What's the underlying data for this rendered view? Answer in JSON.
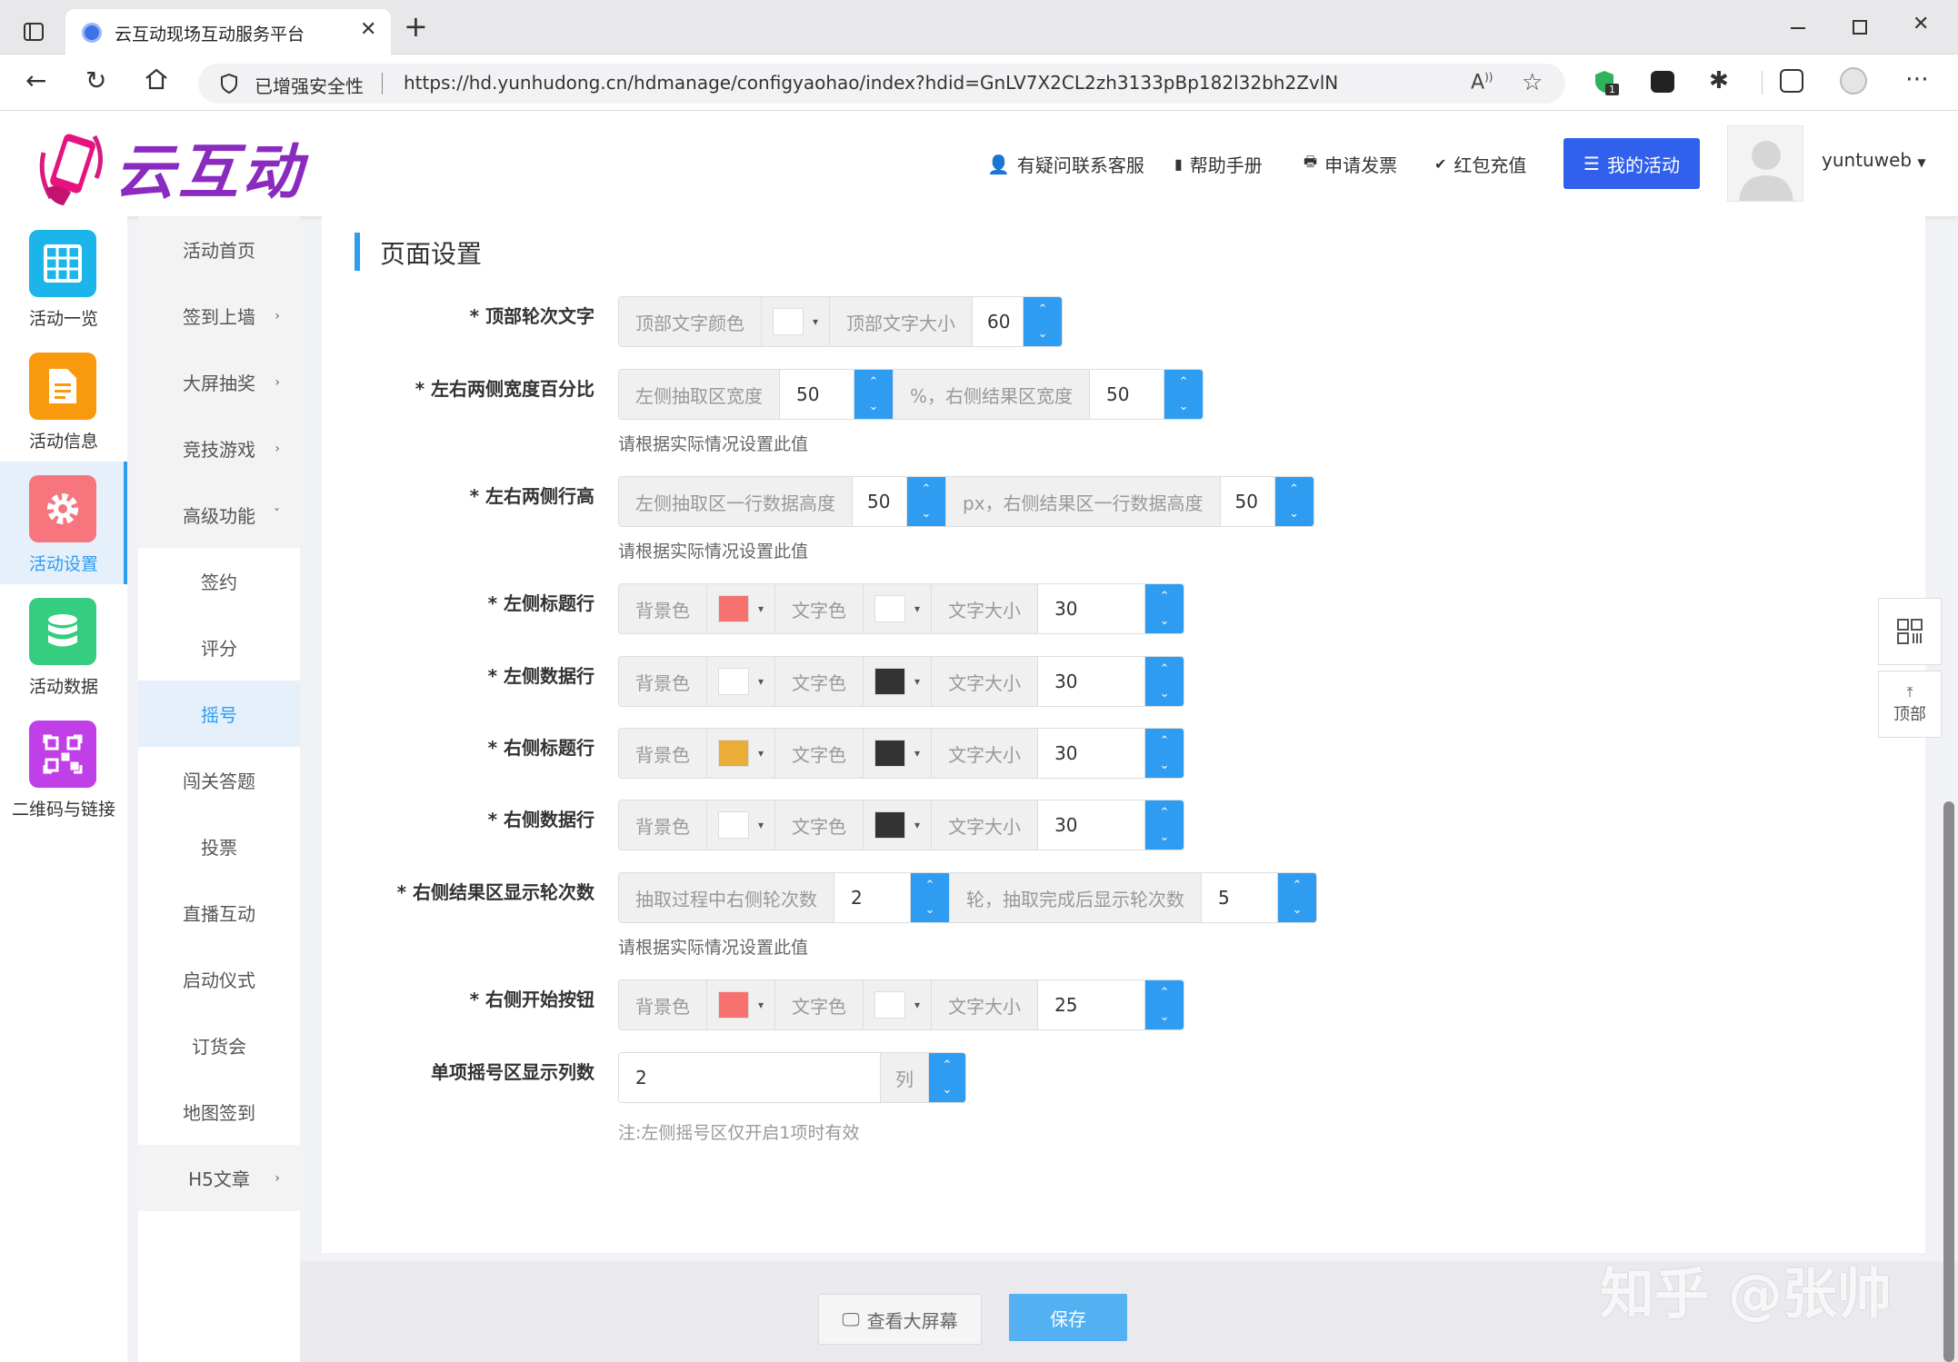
{
  "browser": {
    "tab_title": "云互动现场互动服务平台",
    "security_label": "已增强安全性",
    "url": "https://hd.yunhudong.cn/hdmanage/configyaohao/index?hdid=GnLV7X2CL2zh3133pBp182l32bh2ZvlN",
    "extension_badge": "1"
  },
  "header": {
    "logo_text": "云互动",
    "links": [
      "有疑问联系客服",
      "帮助手册",
      "申请发票",
      "红包充值"
    ],
    "my_activity_button": "我的活动",
    "username": "yuntuweb"
  },
  "sidebar": {
    "items": [
      {
        "label": "活动一览",
        "color": "#1cb5ea",
        "icon": "grid-icon"
      },
      {
        "label": "活动信息",
        "color": "#f99a0e",
        "icon": "document-icon"
      },
      {
        "label": "活动设置",
        "color": "#f7767e",
        "icon": "gear-icon"
      },
      {
        "label": "活动数据",
        "color": "#35cd7f",
        "icon": "database-icon"
      },
      {
        "label": "二维码与链接",
        "color": "#c13fe6",
        "icon": "qrcode-icon"
      }
    ],
    "active_index": 2
  },
  "subnav": {
    "items": [
      "活动首页",
      "签到上墙",
      "大屏抽奖",
      "竞技游戏",
      "高级功能",
      "签约",
      "评分",
      "摇号",
      "闯关答题",
      "投票",
      "直播互动",
      "启动仪式",
      "订货会",
      "地图签到",
      "H5文章"
    ],
    "active": "摇号"
  },
  "form": {
    "section_title": "页面设置",
    "hint": "请根据实际情况设置此值",
    "rows": {
      "top_text": {
        "label": "* 顶部轮次文字",
        "addon1": "顶部文字颜色",
        "addon2": "顶部文字大小",
        "size": "60"
      },
      "width_pct": {
        "label": "* 左右两侧宽度百分比",
        "addon1": "左侧抽取区宽度",
        "value1": "50",
        "addon2": "%，右侧结果区宽度",
        "value2": "50"
      },
      "row_height": {
        "label": "* 左右两侧行高",
        "addon1": "左侧抽取区一行数据高度",
        "value1": "50",
        "addon2": "px，右侧结果区一行数据高度",
        "value2": "50"
      },
      "left_title": {
        "label": "* 左侧标题行",
        "bg_color": "#f7716f",
        "text_color": "#ffffff",
        "size": "30"
      },
      "left_data": {
        "label": "* 左侧数据行",
        "bg_color": "#ffffff",
        "text_color": "#333333",
        "size": "30"
      },
      "right_title": {
        "label": "* 右侧标题行",
        "bg_color": "#e9ad38",
        "text_color": "#333333",
        "size": "30"
      },
      "right_data": {
        "label": "* 右侧数据行",
        "bg_color": "#ffffff",
        "text_color": "#333333",
        "size": "30"
      },
      "rounds": {
        "label": "* 右侧结果区显示轮次数",
        "addon1": "抽取过程中右侧轮次数",
        "value1": "2",
        "addon2": "轮，抽取完成后显示轮次数",
        "value2": "5"
      },
      "start_button": {
        "label": "* 右侧开始按钮",
        "bg_color": "#f7716f",
        "text_color": "#ffffff",
        "size": "25"
      },
      "columns": {
        "label": "单项摇号区显示列数",
        "value": "2",
        "unit": "列",
        "note": "注:左侧摇号区仅开启1项时有效"
      }
    },
    "bg_label": "背景色",
    "text_color_label": "文字色",
    "text_size_label": "文字大小"
  },
  "footer": {
    "view_screen_button": "查看大屏幕",
    "save_button": "保存"
  },
  "float_tools": {
    "top_label": "顶部"
  },
  "watermark": "知乎 @张帅"
}
